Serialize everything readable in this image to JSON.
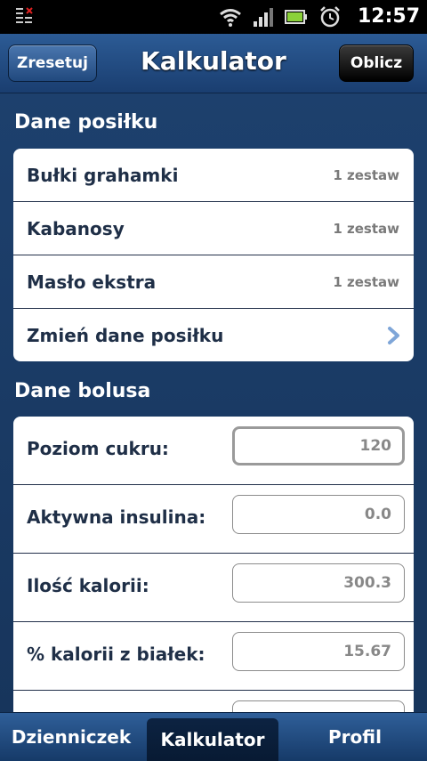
{
  "status_bar": {
    "time": "12:57",
    "icons": [
      "notification-icon",
      "wifi-icon",
      "signal-icon",
      "battery-icon",
      "alarm-icon"
    ]
  },
  "header": {
    "title": "Kalkulator",
    "reset_label": "Zresetuj",
    "calculate_label": "Oblicz"
  },
  "meal": {
    "section_title": "Dane posiłku",
    "items": [
      {
        "name": "Bułki grahamki",
        "quantity": "1 zestaw"
      },
      {
        "name": "Kabanosy",
        "quantity": "1 zestaw"
      },
      {
        "name": "Masło ekstra",
        "quantity": "1 zestaw"
      }
    ],
    "change_label": "Zmień dane posiłku"
  },
  "bolus": {
    "section_title": "Dane bolusa",
    "fields": [
      {
        "label": "Poziom cukru:",
        "value": "120"
      },
      {
        "label": "Aktywna insulina:",
        "value": "0.0"
      },
      {
        "label": "Ilość kalorii:",
        "value": "300.3"
      },
      {
        "label": "% kalorii z białek:",
        "value": "15.67"
      }
    ]
  },
  "tabs": [
    {
      "label": "Dzienniczek"
    },
    {
      "label": "Kalkulator"
    },
    {
      "label": "Profil"
    }
  ],
  "colors": {
    "background": "#1b3a63",
    "header": "#2c5b95",
    "text_dark": "#1f2f47"
  }
}
